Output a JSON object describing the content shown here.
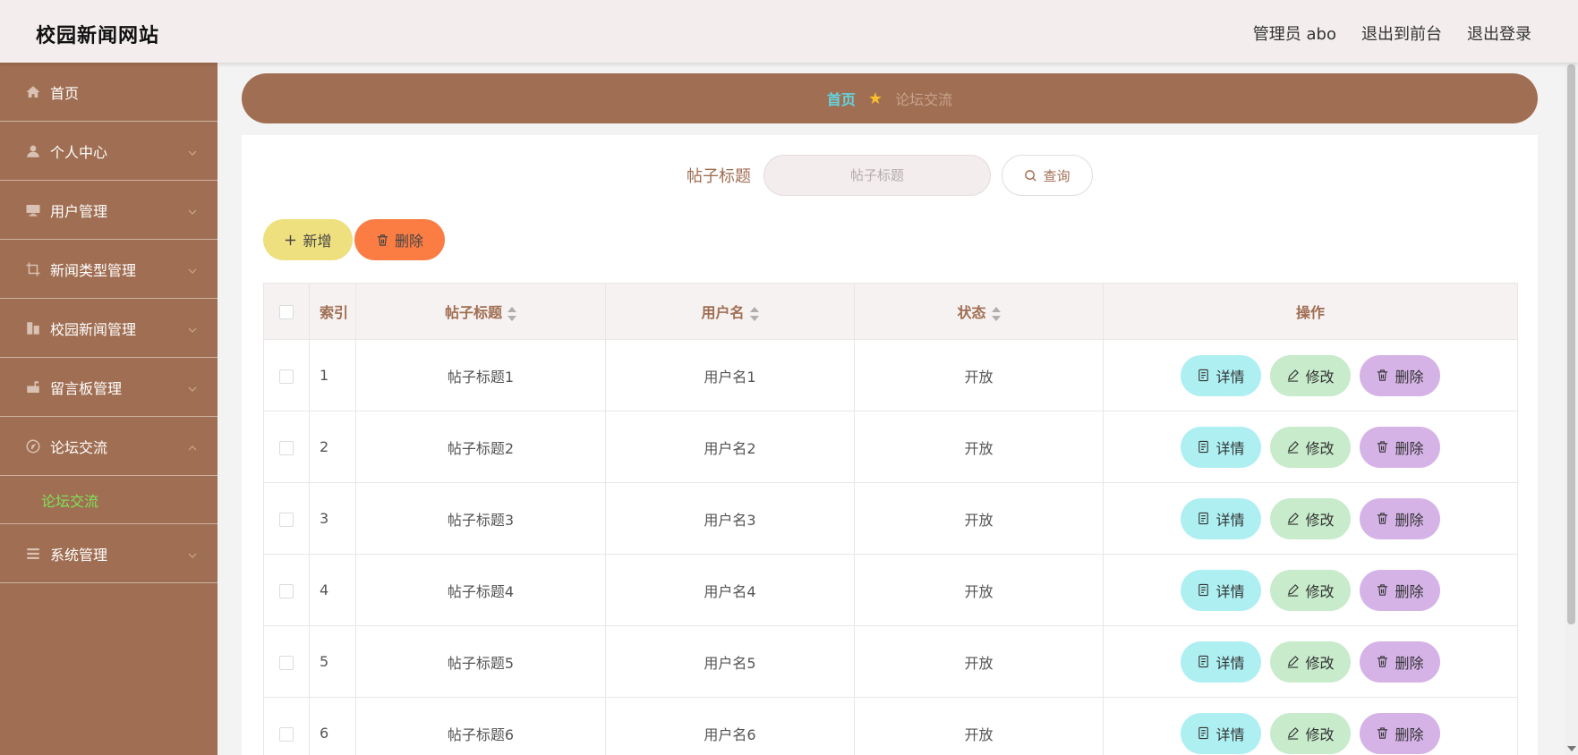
{
  "header": {
    "title": "校园新闻网站",
    "user": "管理员 abo",
    "front_link": "退出到前台",
    "logout_link": "退出登录"
  },
  "sidebar": {
    "items": [
      {
        "label": "首页",
        "icon": "home-icon"
      },
      {
        "label": "个人中心",
        "icon": "user-icon"
      },
      {
        "label": "用户管理",
        "icon": "monitor-icon"
      },
      {
        "label": "新闻类型管理",
        "icon": "crop-icon"
      },
      {
        "label": "校园新闻管理",
        "icon": "building-icon"
      },
      {
        "label": "留言板管理",
        "icon": "mailbox-icon"
      },
      {
        "label": "论坛交流",
        "icon": "compass-icon"
      },
      {
        "label": "系统管理",
        "icon": "list-icon"
      }
    ],
    "subitem": "论坛交流",
    "active_color": "#7fe35a"
  },
  "breadcrumb": {
    "home": "首页",
    "current": "论坛交流"
  },
  "search": {
    "label": "帖子标题",
    "placeholder": "帖子标题",
    "button": "查询"
  },
  "actions": {
    "add": "新增",
    "delete": "删除"
  },
  "table": {
    "headers": {
      "index": "索引",
      "title": "帖子标题",
      "user": "用户名",
      "status": "状态",
      "ops": "操作"
    },
    "op_labels": {
      "detail": "详情",
      "edit": "修改",
      "remove": "删除"
    },
    "rows": [
      {
        "index": "1",
        "title": "帖子标题1",
        "user": "用户名1",
        "status": "开放"
      },
      {
        "index": "2",
        "title": "帖子标题2",
        "user": "用户名2",
        "status": "开放"
      },
      {
        "index": "3",
        "title": "帖子标题3",
        "user": "用户名3",
        "status": "开放"
      },
      {
        "index": "4",
        "title": "帖子标题4",
        "user": "用户名4",
        "status": "开放"
      },
      {
        "index": "5",
        "title": "帖子标题5",
        "user": "用户名5",
        "status": "开放"
      },
      {
        "index": "6",
        "title": "帖子标题6",
        "user": "用户名6",
        "status": "开放"
      }
    ]
  },
  "colors": {
    "brand": "#a06e52",
    "header_bg": "#f3eded",
    "add_button": "#efe07f",
    "delete_button": "#fb7d44",
    "detail_button": "#aeeff2",
    "edit_button": "#c7ebcb",
    "remove_button": "#d5b3e7"
  }
}
